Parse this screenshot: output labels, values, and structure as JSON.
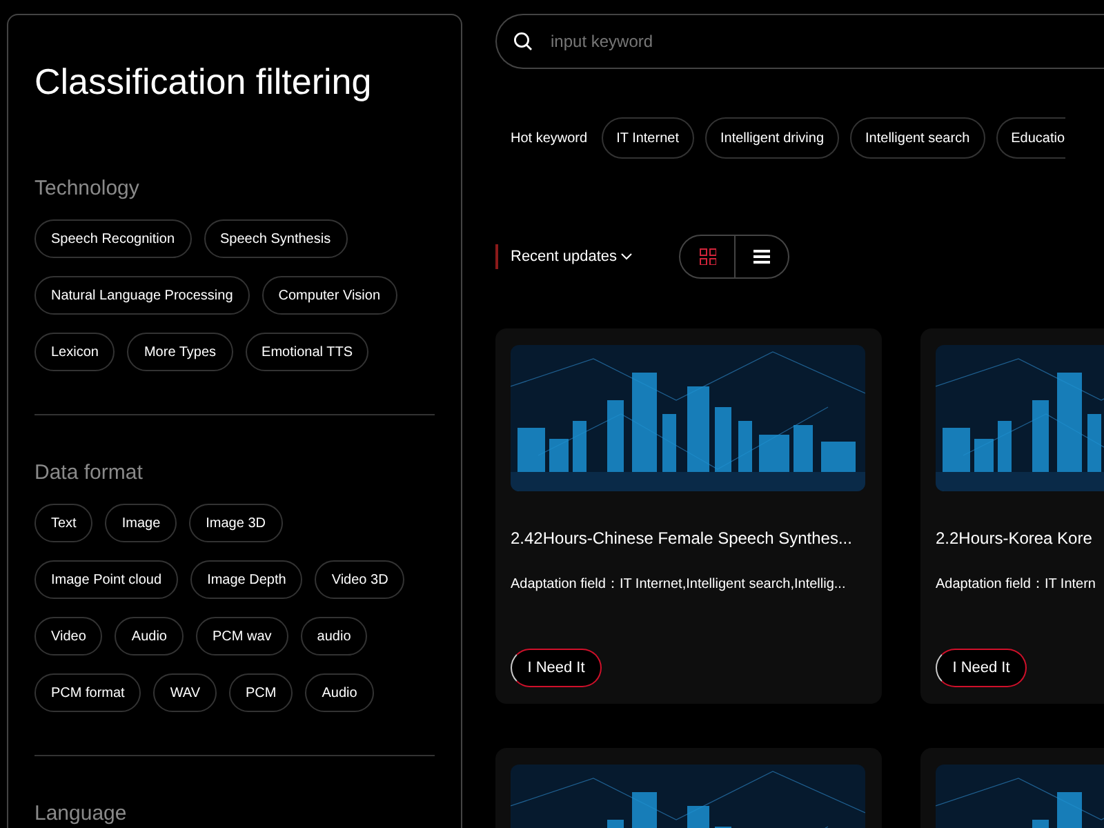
{
  "sidebar": {
    "title": "Classification filtering",
    "sections": [
      {
        "heading": "Technology",
        "tags": [
          "Speech Recognition",
          "Speech Synthesis",
          "Natural Language Processing",
          "Computer Vision",
          "Lexicon",
          "More Types",
          "Emotional TTS"
        ]
      },
      {
        "heading": "Data format",
        "tags": [
          "Text",
          "Image",
          "Image 3D",
          "Image Point cloud",
          "Image Depth",
          "Video 3D",
          "Video",
          "Audio",
          "PCM wav",
          "audio",
          "PCM format",
          "WAV",
          "PCM",
          "Audio"
        ]
      },
      {
        "heading": "Language"
      }
    ]
  },
  "search": {
    "placeholder": "input keyword"
  },
  "hot_keywords": {
    "label": "Hot keyword",
    "items": [
      "IT Internet",
      "Intelligent driving",
      "Intelligent search",
      "Educatio"
    ]
  },
  "sort": {
    "label": "Recent updates"
  },
  "view_toggle": [
    {
      "kind": "grid",
      "selected": true
    },
    {
      "kind": "list",
      "selected": false
    }
  ],
  "cards": [
    {
      "title": "2.42Hours-Chinese Female Speech Synthes...",
      "field": "Adaptation field：IT Internet,Intelligent search,Intellig...",
      "button": "I Need It"
    },
    {
      "title": "2.2Hours-Korea Kore",
      "field": "Adaptation field：IT Intern",
      "button": "I Need It"
    }
  ]
}
